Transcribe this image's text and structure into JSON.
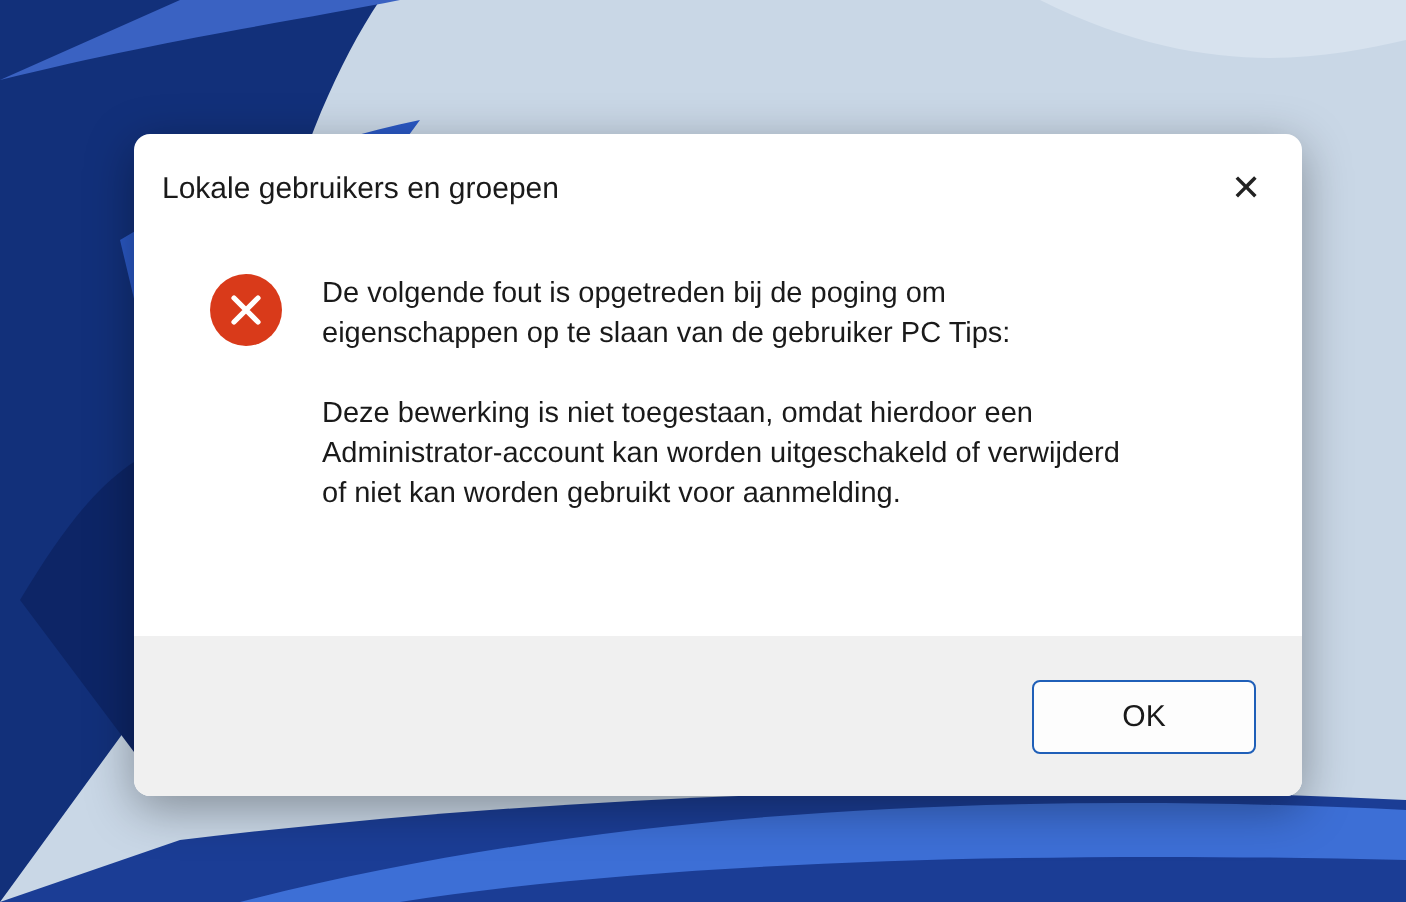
{
  "dialog": {
    "title": "Lokale gebruikers en groepen",
    "close": "✕",
    "kind": "error",
    "paragraphs": [
      "De volgende fout is opgetreden bij de poging om eigenschappen op te slaan van de gebruiker PC Tips:",
      "Deze bewerking is niet toegestaan, omdat hierdoor een Administrator-account kan worden uitgeschakeld of verwijderd of niet kan worden gebruikt voor aanmelding."
    ],
    "buttons": [
      {
        "label": "OK",
        "selected": true
      }
    ]
  }
}
